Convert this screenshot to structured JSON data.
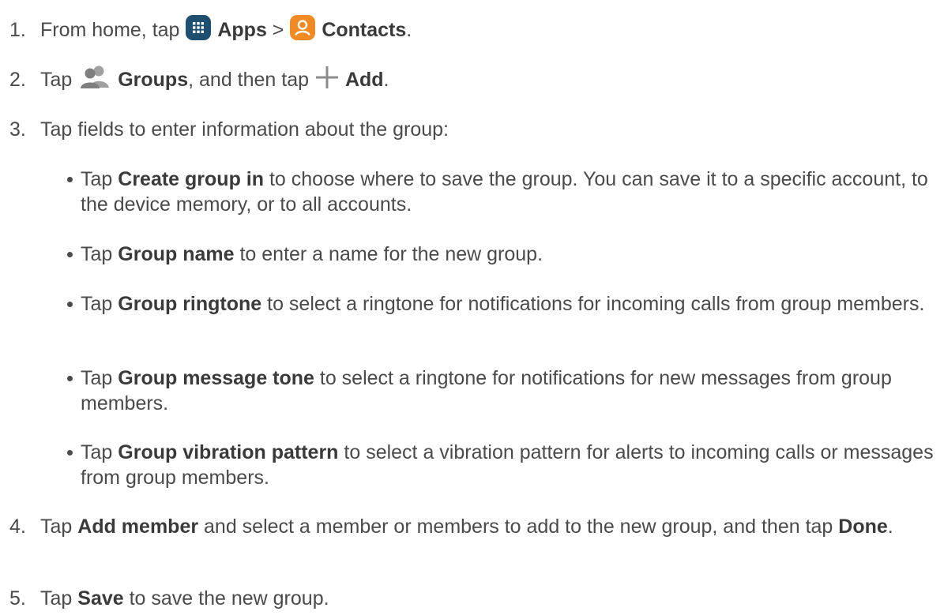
{
  "steps": [
    {
      "num": "1.",
      "pre": "From home, tap ",
      "apps": "Apps",
      "sep": " > ",
      "contacts": "Contacts",
      "end": "."
    },
    {
      "num": "2.",
      "pre": "Tap ",
      "groups": "Groups",
      "mid": ", and then tap ",
      "add": "Add",
      "end": "."
    },
    {
      "num": "3.",
      "text": "Tap fields to enter information about the group:"
    },
    {
      "num": "4.",
      "pre": "Tap ",
      "b1": "Add member",
      "mid": " and select a member or members to add to the new group, and then tap ",
      "b2": "Done",
      "end": "."
    },
    {
      "num": "5.",
      "pre": "Tap ",
      "b1": "Save",
      "end": " to save the new group."
    }
  ],
  "bullets": [
    {
      "pre": "Tap ",
      "bold": "Create group in",
      "post": " to choose where to save the group. You can save it to a specific account, to the device memory, or to all accounts."
    },
    {
      "pre": "Tap ",
      "bold": "Group name",
      "post": " to enter a name for the new group."
    },
    {
      "pre": "Tap ",
      "bold": "Group ringtone",
      "post": " to select a ringtone for notifications for incoming calls from group members."
    },
    {
      "pre": "Tap ",
      "bold": "Group message tone",
      "post": " to select a ringtone for notifications for new messages from group members."
    },
    {
      "pre": "Tap ",
      "bold": "Group vibration pattern",
      "post": " to select a vibration pattern for alerts to incoming calls or messages from group members."
    }
  ],
  "icons": {
    "apps": "apps-grid-icon",
    "contacts": "contacts-icon",
    "groups": "groups-icon",
    "add": "plus-icon"
  },
  "colors": {
    "text": "#4a4a4a",
    "apps_icon": "#1f4f6e",
    "contacts_icon": "#f08a24",
    "groups_icon": "#8c8c8c",
    "add_icon": "#8c8c8c"
  }
}
